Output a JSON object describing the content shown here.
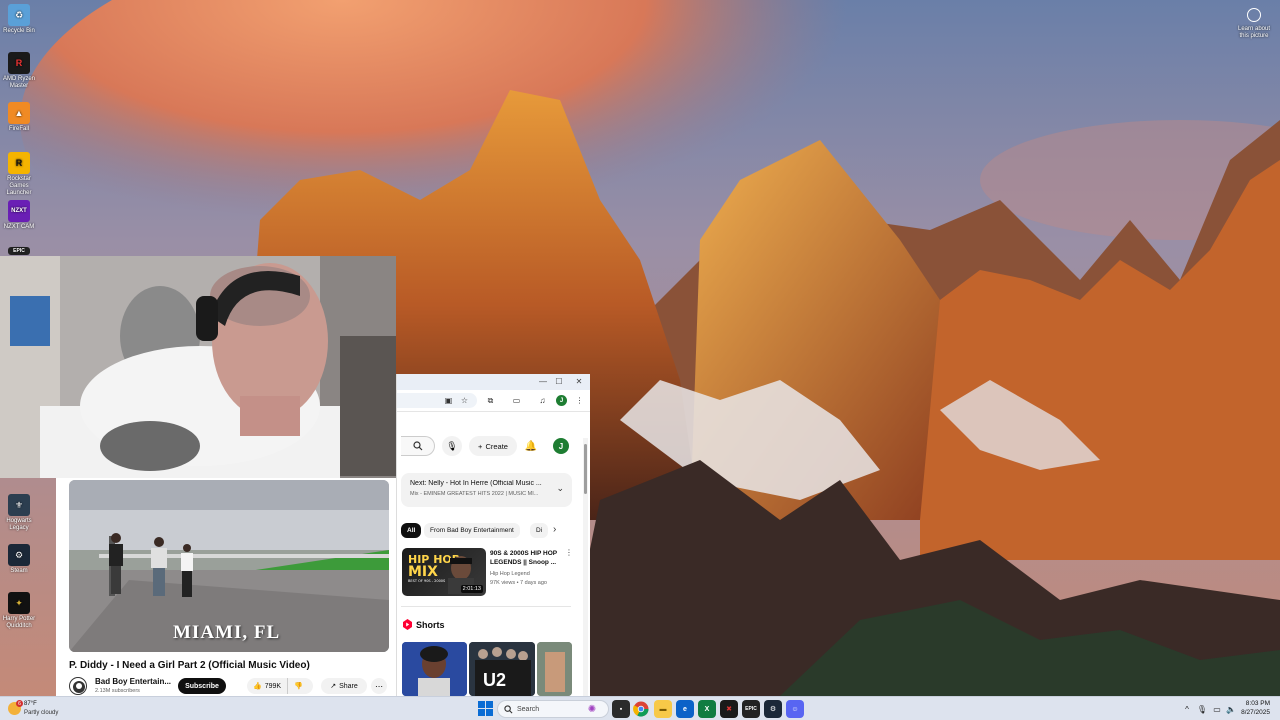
{
  "desktop": {
    "icons": [
      {
        "label": "Recycle Bin",
        "icon": "recycle-bin-icon",
        "color": "#5aa0d8"
      },
      {
        "label": "AMD Ryzen Master",
        "icon": "ryzen-master-icon",
        "color": "#1a1a1a"
      },
      {
        "label": "FireFall",
        "icon": "firefall-icon",
        "color": "#f08a24"
      },
      {
        "label": "Rockstar Games Launcher",
        "icon": "rockstar-icon",
        "color": "#f5b400"
      },
      {
        "label": "NZXT CAM",
        "icon": "nzxt-cam-icon",
        "color": "#6a1fb5"
      },
      {
        "label": "Epic",
        "icon": "epic-games-icon",
        "color": "#222222"
      },
      {
        "label": "Hogwarts Legacy",
        "icon": "hogwarts-legacy-icon",
        "color": "#2c3e50"
      },
      {
        "label": "Steam",
        "icon": "steam-icon",
        "color": "#1b2838"
      },
      {
        "label": "Harry Potter Quidditch",
        "icon": "quidditch-icon",
        "color": "#111111"
      }
    ],
    "icon_glyphs": {
      "rockstar": "R",
      "nzxt": "NZXT",
      "epic": "EPIC",
      "ryzen": "R"
    },
    "learn_label": "Learn about this picture"
  },
  "video_panel": {
    "caption": "MIAMI, FL",
    "title": "P. Diddy - I Need a Girl Part 2 (Official Music Video)",
    "channel": "Bad Boy Entertain...",
    "subscribers": "2.13M subscribers",
    "subscribe_label": "Subscribe",
    "likes": "799K",
    "share_label": "Share",
    "more_label": "⋯"
  },
  "browser": {
    "profile_initial": "J",
    "create_label": "Create",
    "next": {
      "title": "Next: Nelly - Hot In Herre (Official Music ...",
      "subtitle": "Mix - EMINEM GREATEST HITS 2022 | MUSIC MI..."
    },
    "chips": [
      "All",
      "From Bad Boy Entertainment",
      "Di"
    ],
    "recommendation": {
      "thumb_text_top": "HIP HOP",
      "thumb_text_bottom": "MIX",
      "thumb_sub": "BEST OF 90S - 2000S",
      "duration": "2:01:13",
      "title": "90S & 2000S HIP HOP LEGENDS || Snoop ...",
      "channel": "Hip Hop Legend",
      "meta": "97K views • 7 days ago"
    },
    "shorts_label": "Shorts",
    "shorts_thumb_text": "U2",
    "accent": "#ff0033"
  },
  "taskbar": {
    "weather_temp": "87°F",
    "weather_desc": "Partly cloudy",
    "weather_badge": "6",
    "search_placeholder": "Search",
    "clock_time": "8:03 PM",
    "clock_date": "8/27/2025"
  }
}
